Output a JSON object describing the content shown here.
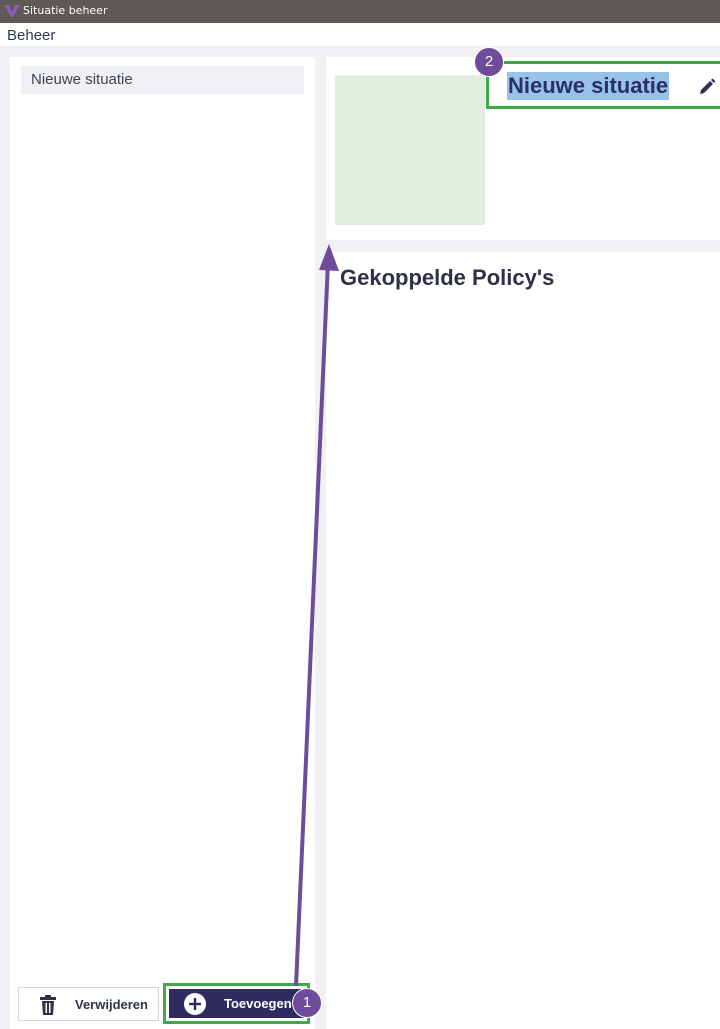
{
  "window": {
    "title": "Situatie beheer"
  },
  "menubar": {
    "items": [
      {
        "label": "Beheer"
      }
    ]
  },
  "sidebar": {
    "items": [
      {
        "label": "Nieuwe situatie"
      }
    ],
    "delete_label": "Verwijderen",
    "add_label": "Toevoegen"
  },
  "detail": {
    "title": "Nieuwe situatie",
    "section_title": "Gekoppelde Policy's"
  },
  "annotations": {
    "badges": [
      {
        "label": "1"
      },
      {
        "label": "2"
      }
    ],
    "colors": {
      "highlight_box": "#3fa847",
      "badge": "#6e4c9a",
      "arrow": "#6e4c9a",
      "primary_button": "#2e2b61"
    }
  }
}
